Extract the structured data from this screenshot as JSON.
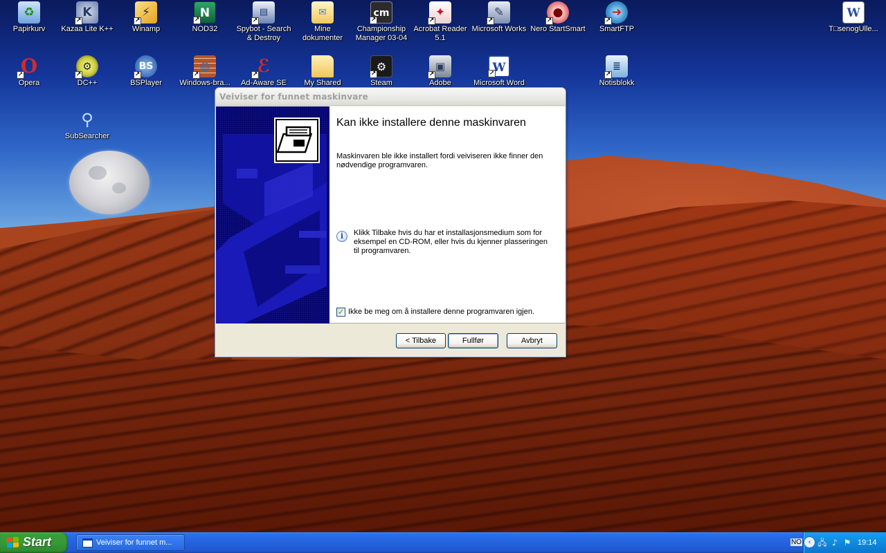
{
  "desktop": {
    "icons": [
      {
        "label": "Papirkurv",
        "glyph": "recycle-bin",
        "color": "#4a8fe0"
      },
      {
        "label": "Kazaa Lite K++",
        "glyph": "kazaa",
        "color": "#6a7fb0"
      },
      {
        "label": "Winamp",
        "glyph": "winamp",
        "color": "#e6a21a"
      },
      {
        "label": "NOD32",
        "glyph": "nod32",
        "color": "#1f7a4a"
      },
      {
        "label": "Spybot - Search & Destroy",
        "glyph": "spybot",
        "color": "#6c85b6"
      },
      {
        "label": "Mine dokumenter",
        "glyph": "my-documents",
        "color": "#f1d36a"
      },
      {
        "label": "Championship Manager 03-04",
        "glyph": "cm",
        "color": "#2b2b2b"
      },
      {
        "label": "Acrobat Reader 5.1",
        "glyph": "acrobat",
        "color": "#c8182a"
      },
      {
        "label": "Microsoft Works",
        "glyph": "works",
        "color": "#7e8fb2"
      },
      {
        "label": "Nero StartSmart",
        "glyph": "nero",
        "color": "#d21f1f"
      },
      {
        "label": "SmartFTP",
        "glyph": "smartftp",
        "color": "#2a8f3a"
      },
      {
        "label": "T□senogUlle...",
        "glyph": "word-document",
        "color": "#2a4f9c"
      },
      {
        "label": "Opera",
        "glyph": "opera",
        "color": "#d22a2a"
      },
      {
        "label": "DC++",
        "glyph": "dcpp",
        "color": "#c9c93a"
      },
      {
        "label": "BSPlayer",
        "glyph": "bsplayer",
        "color": "#3e6fb8"
      },
      {
        "label": "Windows-bra...",
        "glyph": "firewall",
        "color": "#b5532a"
      },
      {
        "label": "Ad-Aware SE",
        "glyph": "ad-aware",
        "color": "#d62a2a"
      },
      {
        "label": "My Shared",
        "glyph": "folder",
        "color": "#f0c75a"
      },
      {
        "label": "Steam",
        "glyph": "steam",
        "color": "#1a1a1a"
      },
      {
        "label": "Adobe",
        "glyph": "adobe",
        "color": "#7d8796"
      },
      {
        "label": "Microsoft Word",
        "glyph": "word",
        "color": "#1f3fa0"
      },
      {
        "label": "Notisblokk",
        "glyph": "notepad",
        "color": "#7fb0e0"
      },
      {
        "label": "SubSearcher",
        "glyph": "magnifier",
        "color": "#8fbbe6"
      }
    ]
  },
  "dialog": {
    "title": "Veiviser for funnet maskinvare",
    "heading": "Kan ikke installere denne maskinvaren",
    "description": "Maskinvaren ble ikke installert fordi veiviseren ikke finner den nødvendige programvaren.",
    "info_text": "Klikk Tilbake hvis du har et installasjonsmedium som for eksempel en CD-ROM, eller hvis du kjenner plasseringen til programvaren.",
    "checkbox_label": "Ikke be meg om å installere denne programvaren igjen.",
    "checkbox_checked": true,
    "buttons": {
      "back": "< Tilbake",
      "finish": "Fullfør",
      "cancel": "Avbryt"
    }
  },
  "taskbar": {
    "start_label": "Start",
    "task_label": "Veiviser for funnet m...",
    "language": "NO",
    "clock": "19:14"
  }
}
